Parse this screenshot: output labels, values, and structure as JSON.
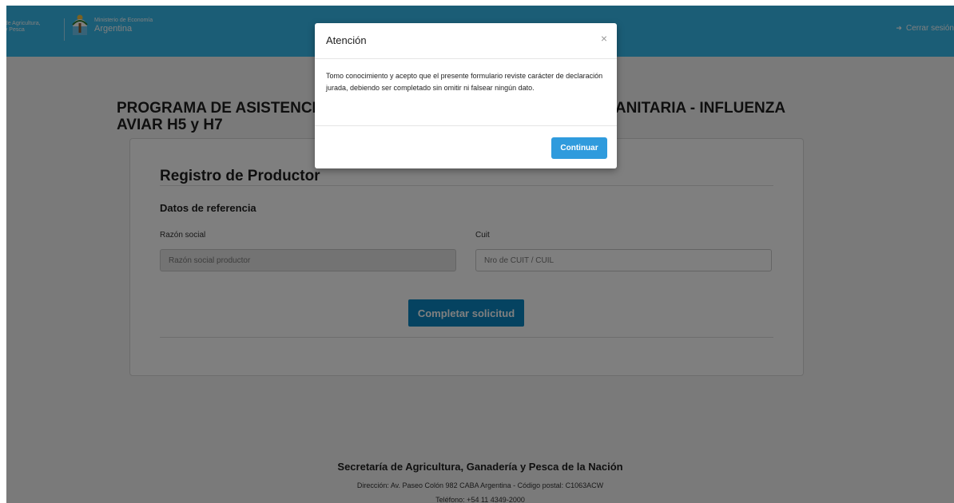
{
  "header": {
    "secretaria_text": "a de Agricultura,\na y Pesca",
    "ministry_small": "Ministerio de Economía",
    "ministry_big": "Argentina",
    "logout_label": "Cerrar sesión",
    "colors": {
      "bar": "#37bbed"
    }
  },
  "main": {
    "title": "PROGRAMA DE ASISTENCIA ECONÓMICA PARA LA EMERGENCIA SANITARIA - INFLUENZA AVIAR H5 y H7",
    "card_title": "Registro de Productor",
    "section_title": "Datos de referencia",
    "fields": [
      {
        "label": "Razón social",
        "placeholder": "Razón social productor",
        "disabled": true
      },
      {
        "label": "Cuit",
        "placeholder": "Nro de CUIT / CUIL",
        "disabled": false
      }
    ],
    "submit_label": "Completar solicitud"
  },
  "footer": {
    "title": "Secretaría de Agricultura, Ganadería y Pesca de la Nación",
    "address": "Dirección: Av. Paseo Colón 982 CABA Argentina - Código postal: C1063ACW",
    "phone": "Teléfono: +54 11 4349-2000"
  },
  "modal": {
    "title": "Atención",
    "close_icon": "×",
    "body": "Tomo conocimiento y acepto que el presente formulario reviste carácter de declaración jurada, debiendo ser completado sin omitir ni falsear ningún dato.",
    "continue_label": "Continuar"
  }
}
